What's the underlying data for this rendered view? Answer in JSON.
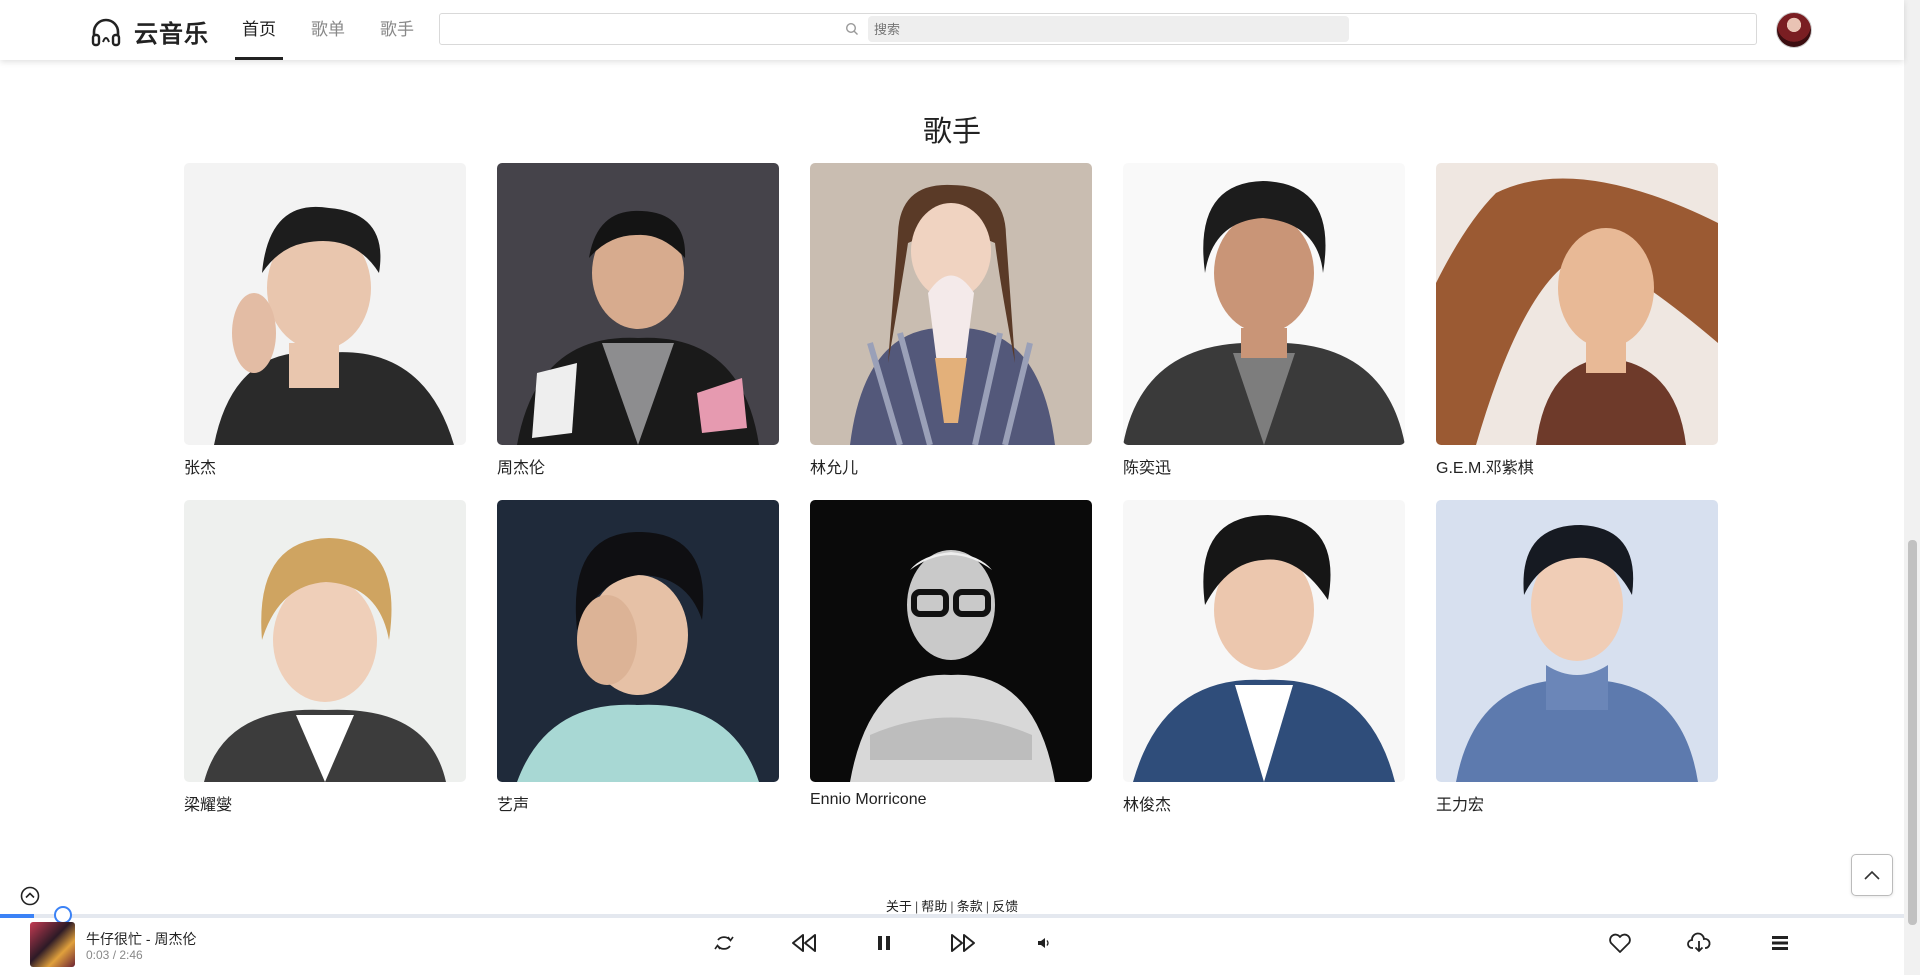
{
  "header": {
    "app_name": "云音乐",
    "nav": [
      {
        "label": "首页",
        "active": true
      },
      {
        "label": "歌单",
        "active": false
      },
      {
        "label": "歌手",
        "active": false
      }
    ],
    "search": {
      "placeholder": "搜索"
    }
  },
  "section": {
    "title": "歌手"
  },
  "artists": [
    {
      "name": "张杰"
    },
    {
      "name": "周杰伦"
    },
    {
      "name": "林允儿"
    },
    {
      "name": "陈奕迅"
    },
    {
      "name": "G.E.M.邓紫棋"
    },
    {
      "name": "梁耀燮"
    },
    {
      "name": "艺声"
    },
    {
      "name": "Ennio Morricone"
    },
    {
      "name": "林俊杰"
    },
    {
      "name": "王力宏"
    }
  ],
  "footer": {
    "links": [
      "关于",
      "帮助",
      "条款",
      "反馈"
    ]
  },
  "player": {
    "song": "牛仔很忙 - 周杰伦",
    "time": "0:03 / 2:46",
    "progress_fraction": 0.018
  },
  "colors": {
    "accent": "#3b82f6",
    "text": "#222222"
  }
}
